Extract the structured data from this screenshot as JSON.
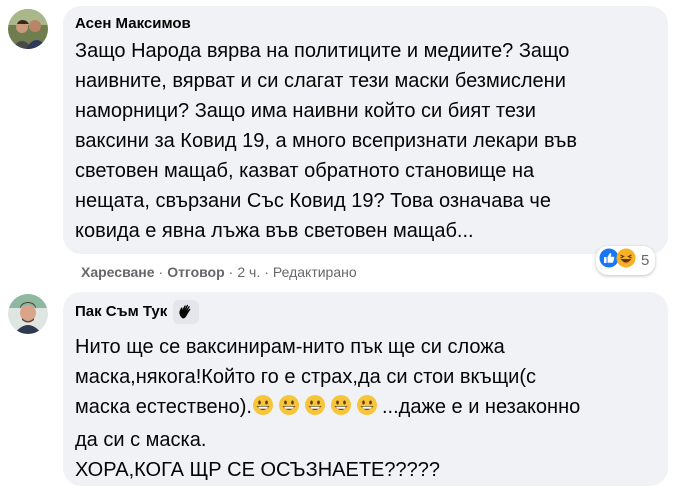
{
  "comments": [
    {
      "author": "Асен Максимов",
      "text_lines": [
        "Защо Народа вярва на политиците и медиите? Защо",
        "наивните, вярват и си слагат тези маски безмислени",
        "наморници? Защо има наивни който си бият тези",
        "ваксини за Ковид 19, а много всепризнати лекари във",
        "световен мащаб, казват обратното становище на",
        "нещата, свързани Със Ковид 19? Това означава че",
        "ковида е явна лъжа във световен мащаб..."
      ],
      "actions": {
        "like": "Харесване",
        "reply": "Отговор",
        "time": "2 ч.",
        "edited": "Редактирано"
      },
      "reactions": {
        "icons": [
          "like-icon",
          "laughing-icon"
        ],
        "count": "5"
      }
    },
    {
      "author": "Пак Съм Тук",
      "badge_icon": "waving-hand-icon",
      "text_lines": [
        "Нито ще се ваксинирам-нито пък ще си сложа",
        "маска,някога!Който го е страх,да си стои вкъщи(с"
      ],
      "line3_before": "маска естествено).",
      "line3_after": "...даже е и незаконно",
      "line3_emoji": "grinning-face-icon",
      "line3_emoji_count": 5,
      "text_tail": [
        "да си с маска.",
        "ХОРА,КОГА ЩР СЕ ОСЪЗНАЕТЕ?????"
      ]
    }
  ],
  "separator": "·",
  "colors": {
    "bubble": "#f0f2f5",
    "meta": "#65676b",
    "like_blue": "#1877f2",
    "emoji_yellow": "#f7b125"
  }
}
